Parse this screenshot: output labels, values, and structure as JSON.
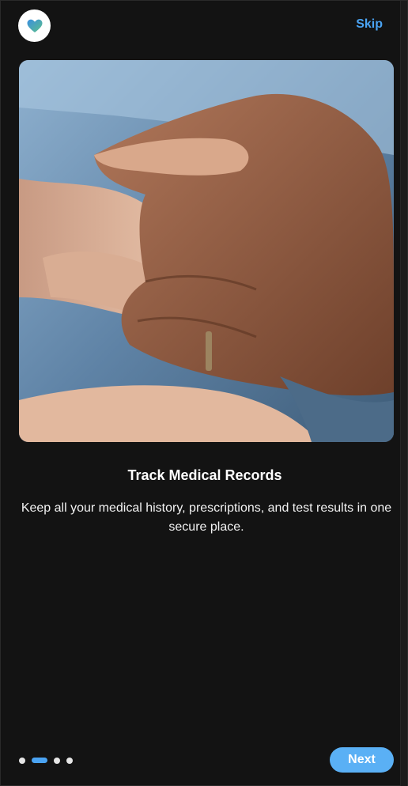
{
  "header": {
    "logo_icon": "heart-icon",
    "skip_label": "Skip"
  },
  "slide": {
    "image_alt": "Two hands holding each other",
    "title": "Track Medical Records",
    "description": "Keep all your medical history, prescriptions, and test results in one secure place."
  },
  "pagination": {
    "total": 4,
    "current": 2
  },
  "footer": {
    "next_label": "Next"
  },
  "colors": {
    "accent": "#4aa3f2",
    "background": "#131313",
    "button": "#5ab0f5"
  }
}
